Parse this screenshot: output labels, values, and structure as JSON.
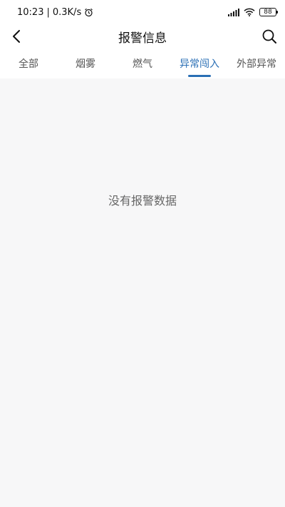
{
  "status_bar": {
    "time": "10:23",
    "network_speed": "0.3K/s",
    "battery": "88",
    "icons": [
      "alarm-icon",
      "signal-icon",
      "wifi-icon",
      "battery-icon"
    ]
  },
  "header": {
    "title": "报警信息",
    "back_icon": "back-arrow-icon",
    "search_icon": "search-icon"
  },
  "tabs": [
    {
      "label": "全部",
      "active": false
    },
    {
      "label": "烟雾",
      "active": false
    },
    {
      "label": "燃气",
      "active": false
    },
    {
      "label": "异常闯入",
      "active": true
    },
    {
      "label": "外部异常",
      "active": false
    }
  ],
  "content": {
    "empty_message": "没有报警数据"
  },
  "colors": {
    "accent": "#2a6fb5",
    "background": "#f7f7f8"
  }
}
